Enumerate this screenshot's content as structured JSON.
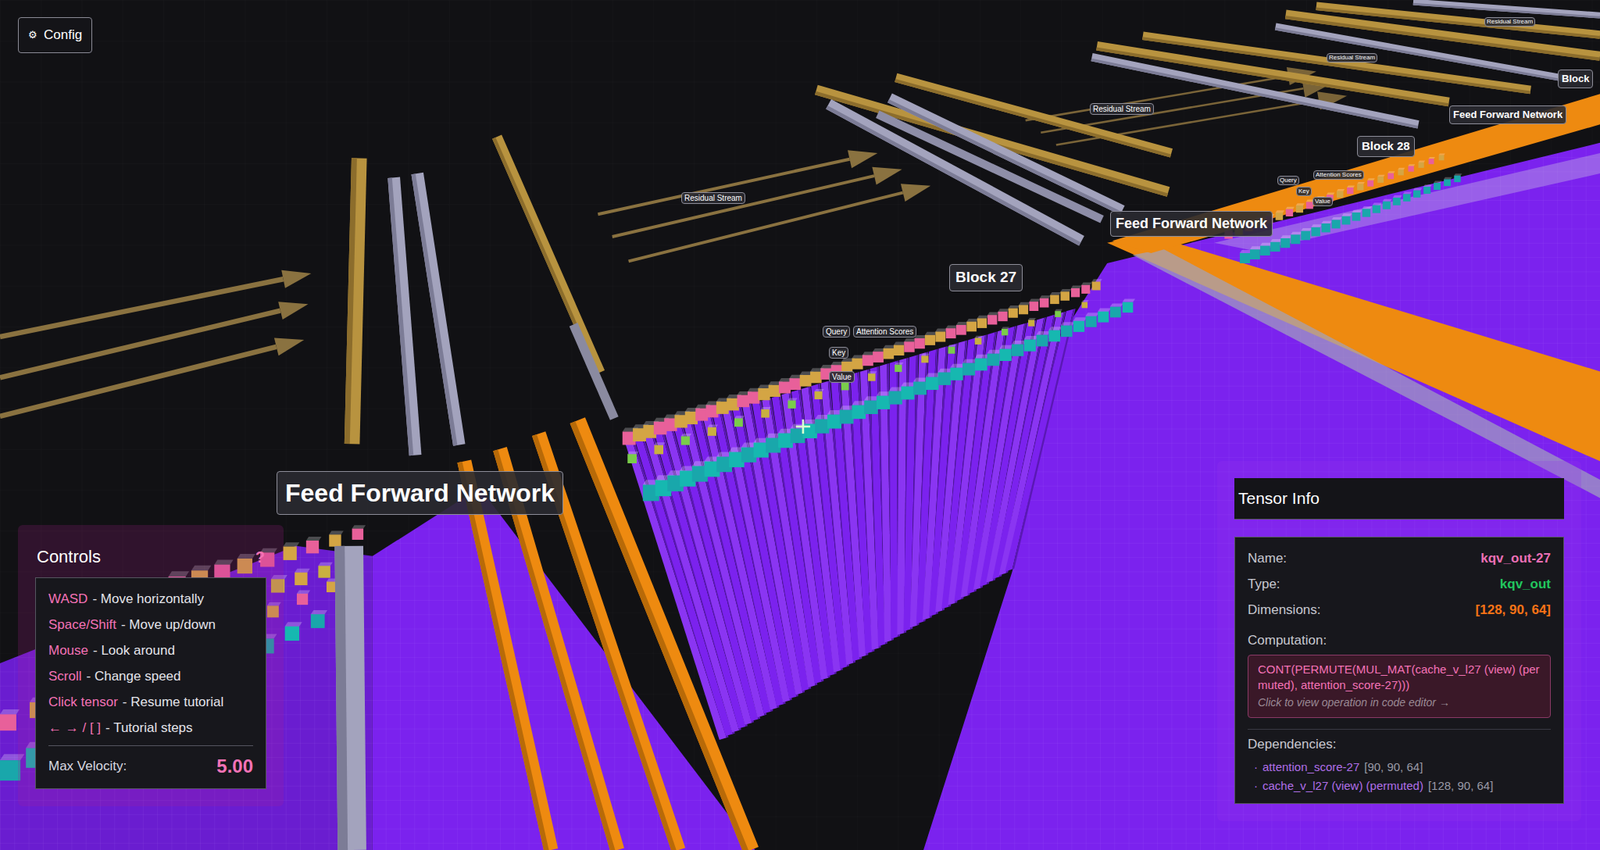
{
  "config_button": {
    "icon": "⚙",
    "label": "Config"
  },
  "scene_labels": [
    {
      "text": "Feed Forward Network"
    },
    {
      "text": "Block 27"
    },
    {
      "text": "Feed Forward Network"
    },
    {
      "text": "Block 28"
    },
    {
      "text": "Feed Forward Network"
    },
    {
      "text": "Block"
    },
    {
      "text": "Residual Stream"
    },
    {
      "text": "Residual Stream"
    },
    {
      "text": "Residual Stream"
    },
    {
      "text": "Residual Stream"
    },
    {
      "text": "Query"
    },
    {
      "text": "Attention Scores"
    },
    {
      "text": "Key"
    },
    {
      "text": "Value"
    },
    {
      "text": "Query"
    },
    {
      "text": "Attention Scores"
    },
    {
      "text": "Key"
    },
    {
      "text": "Value"
    }
  ],
  "controls": {
    "title": "Controls",
    "help": "?",
    "bindings": [
      {
        "key": "WASD",
        "action": "- Move horizontally"
      },
      {
        "key": "Space/Shift",
        "action": "- Move up/down"
      },
      {
        "key": "Mouse",
        "action": "- Look around"
      },
      {
        "key": "Scroll",
        "action": "- Change speed"
      },
      {
        "key": "Click tensor",
        "action": "- Resume tutorial"
      },
      {
        "key": "← → / [ ]",
        "action": "- Tutorial steps"
      }
    ],
    "velocity": {
      "label": "Max Velocity:",
      "value": "5.00"
    }
  },
  "tensor_info": {
    "title": "Tensor Info",
    "fields": [
      {
        "label": "Name:",
        "value": "kqv_out-27",
        "color": "#ec6fb5"
      },
      {
        "label": "Type:",
        "value": "kqv_out",
        "color": "#22c55e"
      },
      {
        "label": "Dimensions:",
        "value": "[128, 90, 64]",
        "color": "#f97316"
      }
    ],
    "computation": {
      "label": "Computation:",
      "code": "CONT(PERMUTE(MUL_MAT(cache_v_l27 (view) (permuted), attention_score-27)))",
      "hint": "Click to view operation in code editor →"
    },
    "dependencies": {
      "label": "Dependencies:",
      "items": [
        {
          "bullet": "·",
          "name": "attention_score-27",
          "dims": "[90, 90, 64]"
        },
        {
          "bullet": "·",
          "name": "cache_v_l27 (view) (permuted)",
          "dims": "[128, 90, 64]"
        }
      ]
    }
  }
}
